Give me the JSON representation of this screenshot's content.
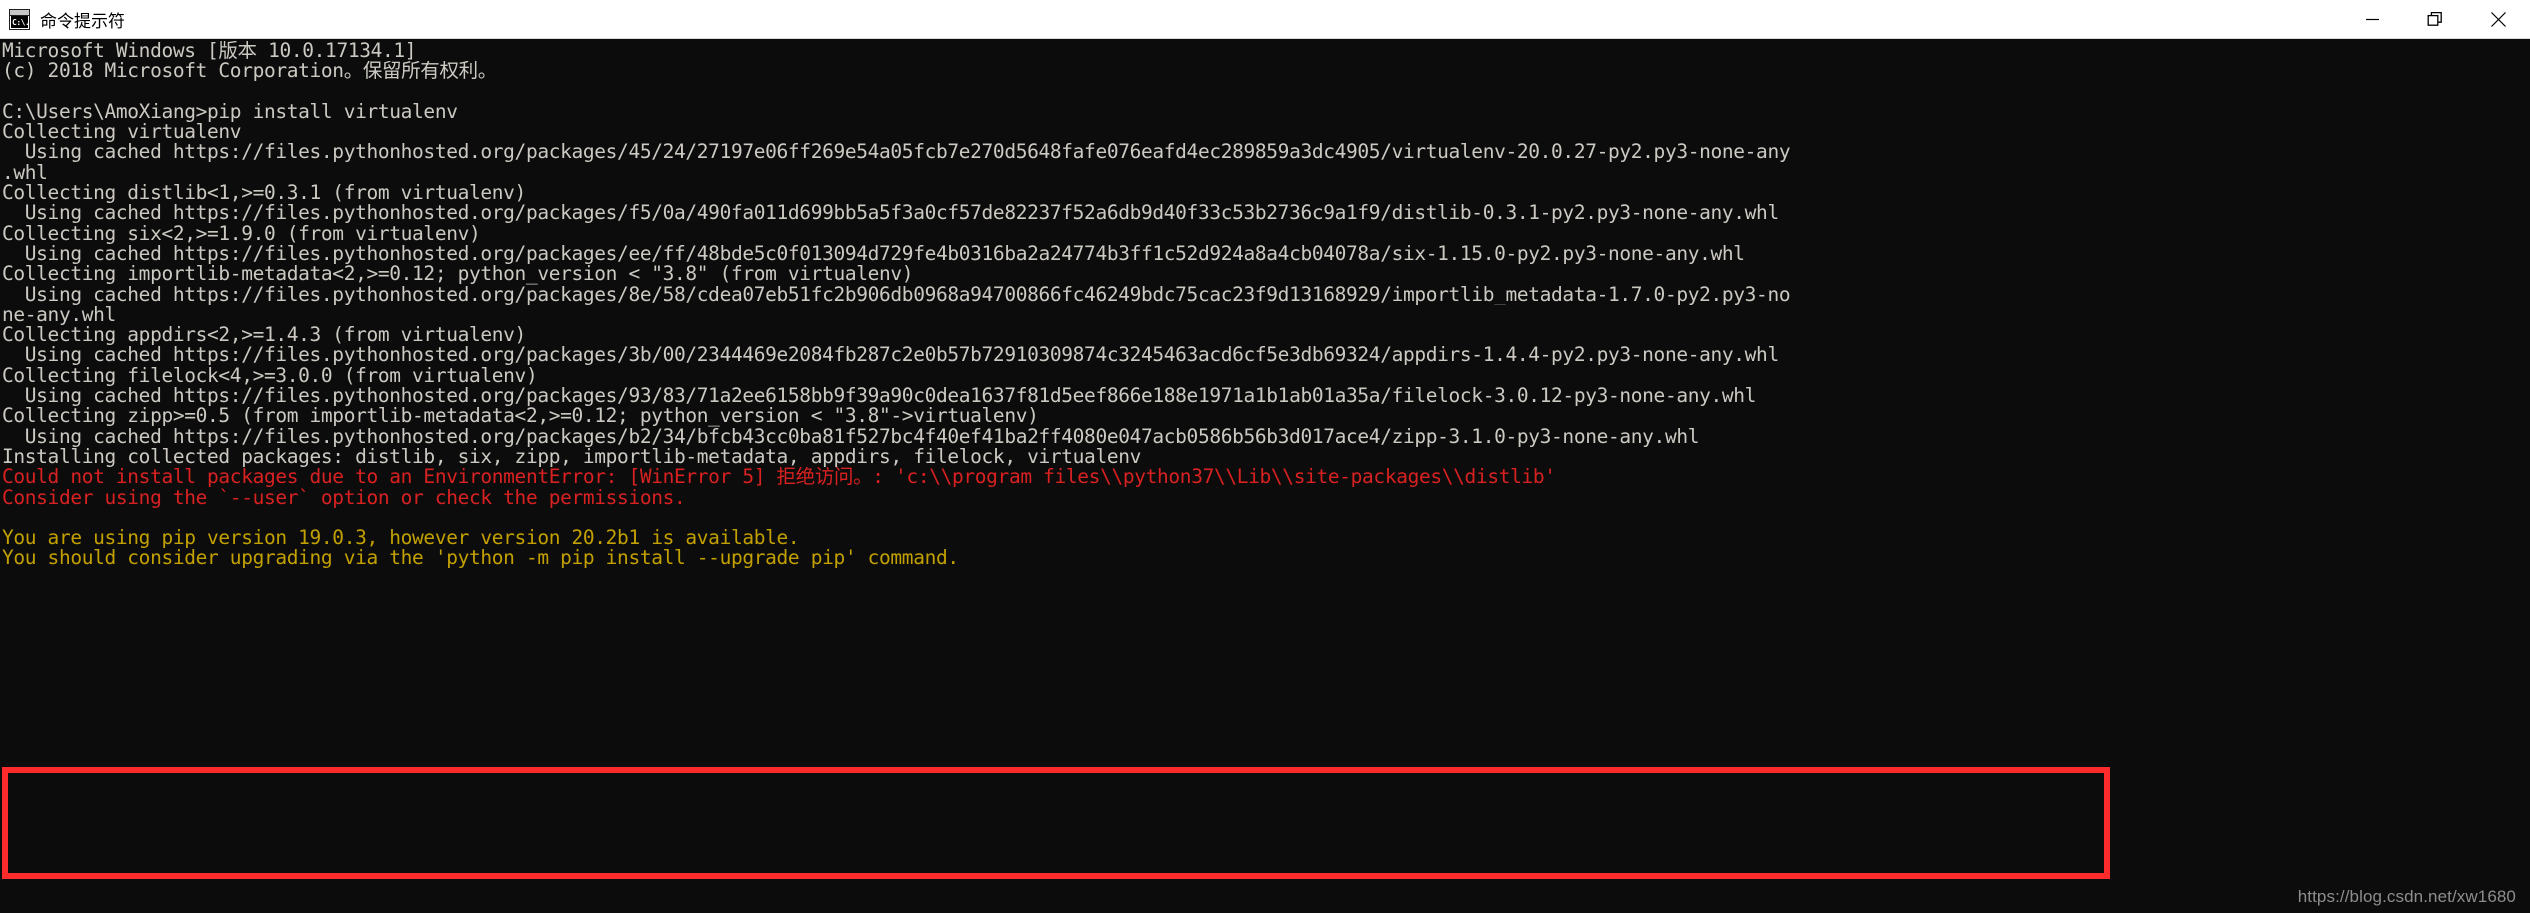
{
  "titlebar": {
    "icon": "cmd-console-icon",
    "title": "命令提示符",
    "minimize_label": "—",
    "maximize_label": "❐",
    "close_label": "✕"
  },
  "colors": {
    "background": "#0c0c0c",
    "foreground": "#ccc9c2",
    "error_red": "#d92121",
    "box_red": "#fc2b2b",
    "warning_yellow": "#c2a000",
    "titlebar_bg": "#ffffff",
    "watermark": "#8d8d8d"
  },
  "terminal": {
    "lines": [
      {
        "text": "Microsoft Windows [版本 10.0.17134.1]",
        "color": "white"
      },
      {
        "text": "(c) 2018 Microsoft Corporation。保留所有权利。",
        "color": "white"
      },
      {
        "text": "",
        "color": "white"
      },
      {
        "text": "C:\\Users\\AmoXiang>pip install virtualenv",
        "color": "white"
      },
      {
        "text": "Collecting virtualenv",
        "color": "white"
      },
      {
        "text": "  Using cached https://files.pythonhosted.org/packages/45/24/27197e06ff269e54a05fcb7e270d5648fafe076eafd4ec289859a3dc4905/virtualenv-20.0.27-py2.py3-none-any",
        "color": "white"
      },
      {
        "text": ".whl",
        "color": "white"
      },
      {
        "text": "Collecting distlib<1,>=0.3.1 (from virtualenv)",
        "color": "white"
      },
      {
        "text": "  Using cached https://files.pythonhosted.org/packages/f5/0a/490fa011d699bb5a5f3a0cf57de82237f52a6db9d40f33c53b2736c9a1f9/distlib-0.3.1-py2.py3-none-any.whl",
        "color": "white"
      },
      {
        "text": "Collecting six<2,>=1.9.0 (from virtualenv)",
        "color": "white"
      },
      {
        "text": "  Using cached https://files.pythonhosted.org/packages/ee/ff/48bde5c0f013094d729fe4b0316ba2a24774b3ff1c52d924a8a4cb04078a/six-1.15.0-py2.py3-none-any.whl",
        "color": "white"
      },
      {
        "text": "Collecting importlib-metadata<2,>=0.12; python_version < \"3.8\" (from virtualenv)",
        "color": "white"
      },
      {
        "text": "  Using cached https://files.pythonhosted.org/packages/8e/58/cdea07eb51fc2b906db0968a94700866fc46249bdc75cac23f9d13168929/importlib_metadata-1.7.0-py2.py3-no",
        "color": "white"
      },
      {
        "text": "ne-any.whl",
        "color": "white"
      },
      {
        "text": "Collecting appdirs<2,>=1.4.3 (from virtualenv)",
        "color": "white"
      },
      {
        "text": "  Using cached https://files.pythonhosted.org/packages/3b/00/2344469e2084fb287c2e0b57b72910309874c3245463acd6cf5e3db69324/appdirs-1.4.4-py2.py3-none-any.whl",
        "color": "white"
      },
      {
        "text": "Collecting filelock<4,>=3.0.0 (from virtualenv)",
        "color": "white"
      },
      {
        "text": "  Using cached https://files.pythonhosted.org/packages/93/83/71a2ee6158bb9f39a90c0dea1637f81d5eef866e188e1971a1b1ab01a35a/filelock-3.0.12-py3-none-any.whl",
        "color": "white"
      },
      {
        "text": "Collecting zipp>=0.5 (from importlib-metadata<2,>=0.12; python_version < \"3.8\"->virtualenv)",
        "color": "white"
      },
      {
        "text": "  Using cached https://files.pythonhosted.org/packages/b2/34/bfcb43cc0ba81f527bc4f40ef41ba2ff4080e047acb0586b56b3d017ace4/zipp-3.1.0-py3-none-any.whl",
        "color": "white"
      },
      {
        "text": "Installing collected packages: distlib, six, zipp, importlib-metadata, appdirs, filelock, virtualenv",
        "color": "white"
      },
      {
        "text": "Could not install packages due to an EnvironmentError: [WinError 5] 拒绝访问。: 'c:\\\\program files\\\\python37\\\\Lib\\\\site-packages\\\\distlib'",
        "color": "red"
      },
      {
        "text": "Consider using the `--user` option or check the permissions.",
        "color": "red"
      },
      {
        "text": "",
        "color": "white"
      },
      {
        "text": "You are using pip version 19.0.3, however version 20.2b1 is available.",
        "color": "yellow"
      },
      {
        "text": "You should consider upgrading via the 'python -m pip install --upgrade pip' command.",
        "color": "yellow"
      }
    ]
  },
  "annotations": {
    "error_box_color": "#fc2b2b"
  },
  "watermark": {
    "text": "https://blog.csdn.net/xw1680"
  }
}
